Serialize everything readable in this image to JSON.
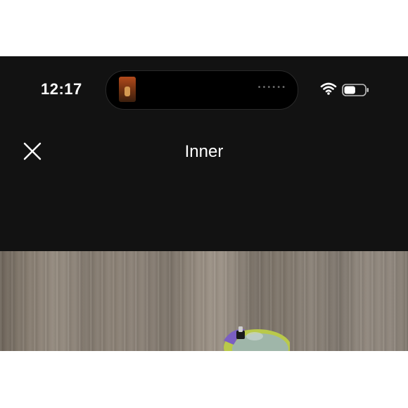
{
  "status_bar": {
    "time": "12:17",
    "dynamic_island": {
      "album_art_icon": "album-art-thumbnail",
      "indicator_icon": "audio-wave-dots"
    },
    "wifi_icon": "wifi-icon",
    "battery_icon": "battery-icon",
    "battery_level": 0.55
  },
  "header": {
    "close_icon": "close-icon",
    "title": "Inner"
  },
  "photo": {
    "content": "product-photo"
  },
  "colors": {
    "background": "#121212",
    "text": "#ffffff"
  }
}
